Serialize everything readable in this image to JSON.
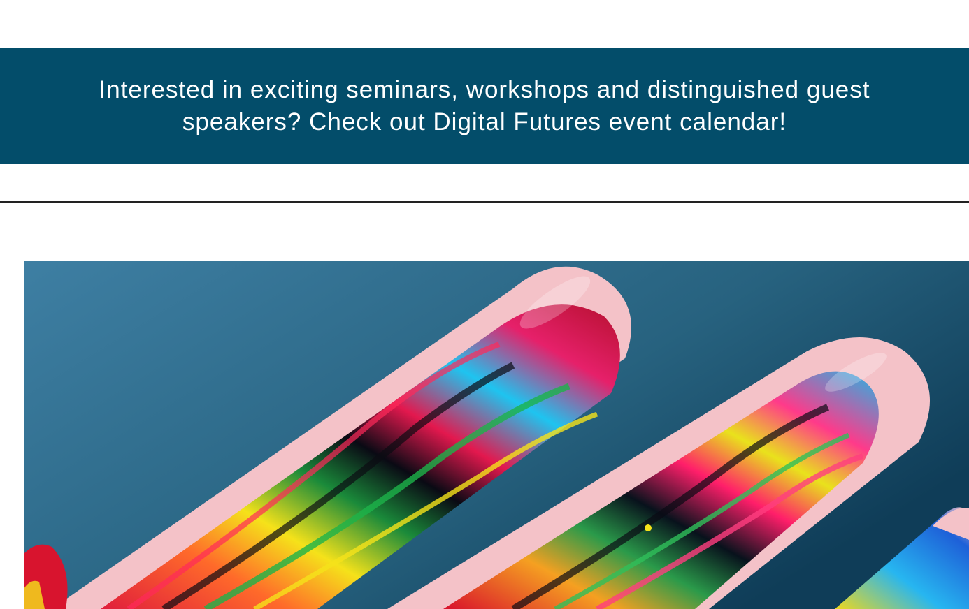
{
  "banner": {
    "text": "Interested in exciting seminars, workshops and distinguished guest speakers? Check out Digital Futures event calendar!"
  },
  "hero_image": {
    "subject": "paint-covered-fingers-photo",
    "background_color": "#2e6f92",
    "skin_color": "#f4c2c8"
  },
  "colors": {
    "banner_bg": "#034d6a",
    "divider": "#222222"
  }
}
